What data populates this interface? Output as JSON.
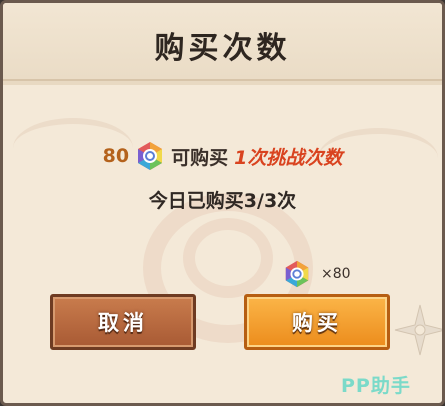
{
  "dialog": {
    "title": "购买次数"
  },
  "cost": {
    "amount": "80",
    "currency_icon": "rainbow-gem-icon",
    "buy_text": "可购买",
    "challenge_text": "1次挑战次数"
  },
  "daily_purchases": "今日已购买3/3次",
  "price": {
    "currency_icon": "rainbow-gem-icon",
    "amount": "×80"
  },
  "buttons": {
    "cancel": "取消",
    "buy": "购买"
  },
  "watermark": "PP助手",
  "colors": {
    "panel": "#f4e9d8",
    "cost_amount": "#b4621c",
    "challenge_text": "#d9431f",
    "cancel_button": "#b8663d",
    "buy_button": "#f49f2e",
    "watermark": "#7bdac9"
  }
}
